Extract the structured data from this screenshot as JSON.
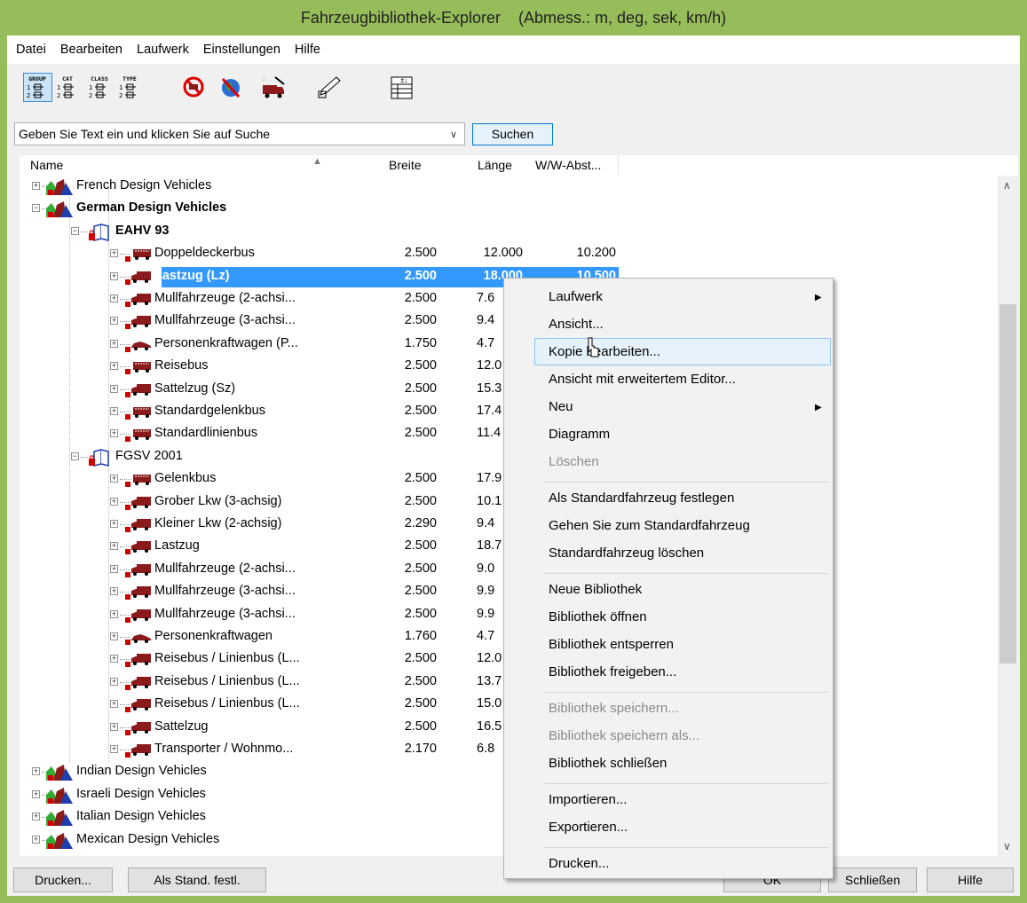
{
  "window": {
    "title": "Fahrzeugbibliothek-Explorer",
    "units": "(Abmess.: m, deg, sek, km/h)"
  },
  "menu": [
    "Datei",
    "Bearbeiten",
    "Laufwerk",
    "Einstellungen",
    "Hilfe"
  ],
  "toolbar": {
    "buttons": [
      {
        "name": "group-view-button",
        "label": "GROUP",
        "active": true
      },
      {
        "name": "cat-view-button",
        "label": "CAT",
        "active": false
      },
      {
        "name": "class-view-button",
        "label": "CLASS",
        "active": false
      },
      {
        "name": "type-view-button",
        "label": "TYPE",
        "active": false
      },
      {
        "name": "no-filter-button",
        "label": "",
        "active": false
      },
      {
        "name": "world-filter-button",
        "label": "",
        "active": false
      },
      {
        "name": "vehicle-button",
        "label": "",
        "active": false
      },
      {
        "name": "edit-button",
        "label": "",
        "active": false
      },
      {
        "name": "columns-button",
        "label": "",
        "active": false
      }
    ]
  },
  "search": {
    "placeholder": "Geben Sie Text ein und klicken Sie auf Suche",
    "button": "Suchen"
  },
  "columns": {
    "name": "Name",
    "width": "Breite",
    "length": "Länge",
    "wheelbase": "W/W-Abst..."
  },
  "tree": [
    {
      "level": 0,
      "kind": "group",
      "name": "French Design Vehicles",
      "exp": "+"
    },
    {
      "level": 0,
      "kind": "group",
      "name": "German Design Vehicles",
      "exp": "-",
      "bold": true
    },
    {
      "level": 1,
      "kind": "book",
      "name": "EAHV 93",
      "exp": "-",
      "bold": true
    },
    {
      "level": 2,
      "kind": "bus",
      "name": "Doppeldeckerbus",
      "breite": "2.500",
      "laenge": "12.000",
      "ww": "10.200"
    },
    {
      "level": 2,
      "kind": "truck",
      "name": "Lastzug (Lz)",
      "breite": "2.500",
      "laenge": "18.000",
      "ww": "10.500",
      "selected": true
    },
    {
      "level": 2,
      "kind": "truck",
      "name": "Mullfahrzeuge (2-achsi...",
      "breite": "2.500",
      "laenge": "7.6"
    },
    {
      "level": 2,
      "kind": "truck",
      "name": "Mullfahrzeuge (3-achsi...",
      "breite": "2.500",
      "laenge": "9.4"
    },
    {
      "level": 2,
      "kind": "car",
      "name": "Personenkraftwagen (P...",
      "breite": "1.750",
      "laenge": "4.7"
    },
    {
      "level": 2,
      "kind": "bus",
      "name": "Reisebus",
      "breite": "2.500",
      "laenge": "12.0"
    },
    {
      "level": 2,
      "kind": "truck",
      "name": "Sattelzug (Sz)",
      "breite": "2.500",
      "laenge": "15.3"
    },
    {
      "level": 2,
      "kind": "bus",
      "name": "Standardgelenkbus",
      "breite": "2.500",
      "laenge": "17.4"
    },
    {
      "level": 2,
      "kind": "bus",
      "name": "Standardlinienbus",
      "breite": "2.500",
      "laenge": "11.4"
    },
    {
      "level": 1,
      "kind": "book",
      "name": "FGSV 2001",
      "exp": "-"
    },
    {
      "level": 2,
      "kind": "bus",
      "name": "Gelenkbus",
      "breite": "2.500",
      "laenge": "17.9"
    },
    {
      "level": 2,
      "kind": "truck",
      "name": "Grober Lkw (3-achsig)",
      "breite": "2.500",
      "laenge": "10.1"
    },
    {
      "level": 2,
      "kind": "truck",
      "name": "Kleiner Lkw (2-achsig)",
      "breite": "2.290",
      "laenge": "9.4"
    },
    {
      "level": 2,
      "kind": "truck",
      "name": "Lastzug",
      "breite": "2.500",
      "laenge": "18.7"
    },
    {
      "level": 2,
      "kind": "truck",
      "name": "Mullfahrzeuge (2-achsi...",
      "breite": "2.500",
      "laenge": "9.0"
    },
    {
      "level": 2,
      "kind": "truck",
      "name": "Mullfahrzeuge (3-achsi...",
      "breite": "2.500",
      "laenge": "9.9"
    },
    {
      "level": 2,
      "kind": "truck",
      "name": "Mullfahrzeuge (3-achsi...",
      "breite": "2.500",
      "laenge": "9.9"
    },
    {
      "level": 2,
      "kind": "car",
      "name": "Personenkraftwagen",
      "breite": "1.760",
      "laenge": "4.7"
    },
    {
      "level": 2,
      "kind": "truck",
      "name": "Reisebus / Linienbus (L...",
      "breite": "2.500",
      "laenge": "12.0"
    },
    {
      "level": 2,
      "kind": "truck",
      "name": "Reisebus / Linienbus (L...",
      "breite": "2.500",
      "laenge": "13.7"
    },
    {
      "level": 2,
      "kind": "truck",
      "name": "Reisebus / Linienbus (L...",
      "breite": "2.500",
      "laenge": "15.0"
    },
    {
      "level": 2,
      "kind": "truck",
      "name": "Sattelzug",
      "breite": "2.500",
      "laenge": "16.5"
    },
    {
      "level": 2,
      "kind": "truck",
      "name": "Transporter / Wohnmo...",
      "breite": "2.170",
      "laenge": "6.8"
    },
    {
      "level": 0,
      "kind": "group",
      "name": "Indian Design Vehicles",
      "exp": "+"
    },
    {
      "level": 0,
      "kind": "group",
      "name": "Israeli Design Vehicles",
      "exp": "+"
    },
    {
      "level": 0,
      "kind": "group",
      "name": "Italian Design Vehicles",
      "exp": "+"
    },
    {
      "level": 0,
      "kind": "group",
      "name": "Mexican Design Vehicles",
      "exp": "+"
    }
  ],
  "context_menu": [
    {
      "label": "Laufwerk",
      "submenu": true
    },
    {
      "label": "Ansicht..."
    },
    {
      "label": "Kopie bearbeiten...",
      "hover": true
    },
    {
      "label": "Ansicht mit erweitertem Editor..."
    },
    {
      "label": "Neu",
      "submenu": true
    },
    {
      "label": "Diagramm"
    },
    {
      "label": "Löschen",
      "disabled": true
    },
    {
      "separator": true
    },
    {
      "label": "Als Standardfahrzeug festlegen"
    },
    {
      "label": "Gehen Sie zum Standardfahrzeug"
    },
    {
      "label": "Standardfahrzeug löschen"
    },
    {
      "separator": true
    },
    {
      "label": "Neue Bibliothek"
    },
    {
      "label": "Bibliothek öffnen"
    },
    {
      "label": "Bibliothek entsperren"
    },
    {
      "label": "Bibliothek freigeben..."
    },
    {
      "separator": true
    },
    {
      "label": "Bibliothek speichern...",
      "disabled": true
    },
    {
      "label": "Bibliothek speichern als...",
      "disabled": true
    },
    {
      "label": "Bibliothek schließen"
    },
    {
      "separator": true
    },
    {
      "label": "Importieren..."
    },
    {
      "label": "Exportieren..."
    },
    {
      "separator": true
    },
    {
      "label": "Drucken..."
    }
  ],
  "bottom_buttons": {
    "print": "Drucken...",
    "set_default": "Als Stand. festl.",
    "ok": "OK",
    "close": "Schließen",
    "help": "Hilfe"
  },
  "colors": {
    "titlebar": "#97bd5a",
    "selection": "#3399ff",
    "vehicle_icon": "#8b1a1a"
  }
}
